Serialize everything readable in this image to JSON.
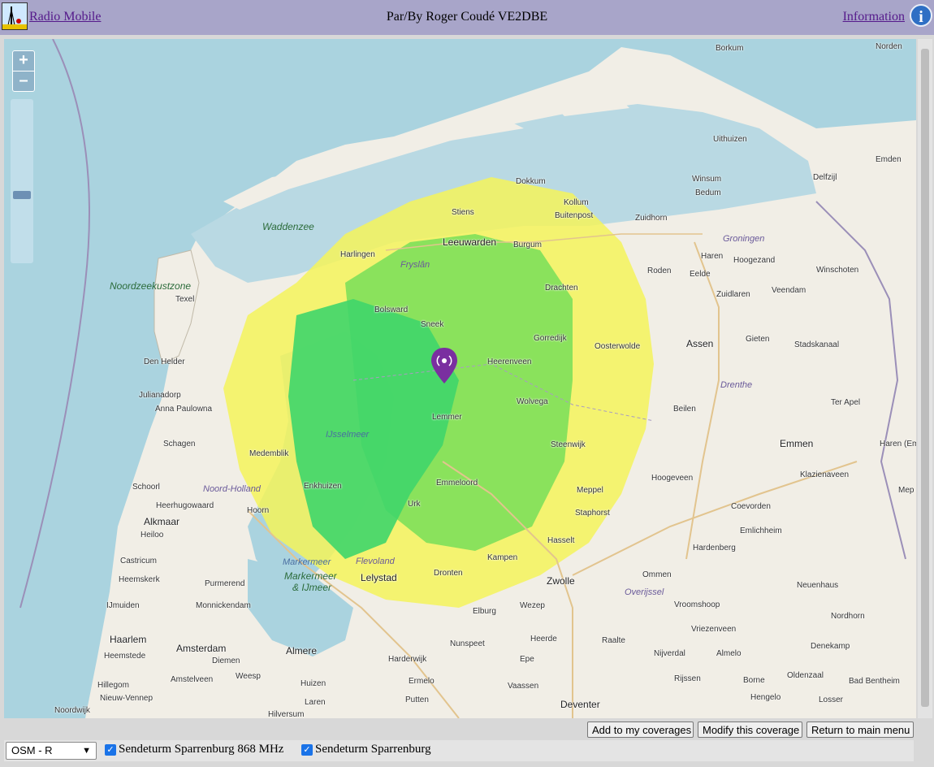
{
  "header": {
    "app_name": "Radio Mobile",
    "author": "Par/By Roger Coudé VE2DBE",
    "info_link": "Information",
    "info_icon": "i"
  },
  "map": {
    "zoom_in": "+",
    "zoom_out": "–",
    "attribution_icon": "i",
    "places": {
      "borkum": "Borkum",
      "norden": "Norden",
      "uithuizen": "Uithuizen",
      "emden": "Emden",
      "delfzijl": "Delfzijl",
      "winsum": "Winsum",
      "bedum": "Bedum",
      "dokkum": "Dokkum",
      "kollum": "Kollum",
      "buitenpost": "Buitenpost",
      "zuidhorn": "Zuidhorn",
      "stiens": "Stiens",
      "leeuwarden": "Leeuwarden",
      "burgum": "Burgum",
      "groningen": "Groningen",
      "haren": "Haren",
      "hoogezand": "Hoogezand",
      "winschoten": "Winschoten",
      "harlingen": "Harlingen",
      "fryslan": "Fryslân",
      "roden": "Roden",
      "eelde": "Eelde",
      "zuidlaren": "Zuidlaren",
      "veendam": "Veendam",
      "drachten": "Drachten",
      "texel": "Texel",
      "bolsward": "Bolsward",
      "sneek": "Sneek",
      "gorredijk": "Gorredijk",
      "assen": "Assen",
      "gieten": "Gieten",
      "stadskanaal": "Stadskanaal",
      "oosterwolde": "Oosterwolde",
      "den_helder": "Den Helder",
      "heerenveen": "Heerenveen",
      "drenthe": "Drenthe",
      "julianadorp": "Julianadorp",
      "wolvega": "Wolvega",
      "ter_apel": "Ter Apel",
      "anna_paulowna": "Anna Paulowna",
      "lemmer": "Lemmer",
      "beilen": "Beilen",
      "schagen": "Schagen",
      "medemblik": "Medemblik",
      "ijsselmeer": "IJsselmeer",
      "steenwijk": "Steenwijk",
      "emmen": "Emmen",
      "haren_ems": "Haren (Em",
      "klazienaveen": "Klazienaveen",
      "hoogeveen": "Hoogeveen",
      "schoorl": "Schoorl",
      "noord_holland": "Noord-Holland",
      "enkhuizen": "Enkhuizen",
      "emmeloord": "Emmeloord",
      "meppel": "Meppel",
      "mep": "Mep",
      "heerhugowaard": "Heerhugowaard",
      "hoorn": "Hoorn",
      "urk": "Urk",
      "staphorst": "Staphorst",
      "coevorden": "Coevorden",
      "alkmaar": "Alkmaar",
      "heiloo": "Heiloo",
      "emlichheim": "Emlichheim",
      "hasselt": "Hasselt",
      "castricum": "Castricum",
      "markermeer": "Markermeer",
      "flevoland": "Flevoland",
      "kampen": "Kampen",
      "hardenberg": "Hardenberg",
      "heemskerk": "Heemskerk",
      "purmerend": "Purmerend",
      "lelystad": "Lelystad",
      "dronten": "Dronten",
      "zwolle": "Zwolle",
      "ommen": "Ommen",
      "neuenhaus": "Neuenhaus",
      "markermeer_ijmeer_1": "Markermeer",
      "markermeer_ijmeer_2": "& IJmeer",
      "ijmuiden": "IJmuiden",
      "monnickendam": "Monnickendam",
      "overijssel": "Overijssel",
      "elburg": "Elburg",
      "wezep": "Wezep",
      "vroomshoop": "Vroomshoop",
      "nordhorn": "Nordhorn",
      "haarlem": "Haarlem",
      "amsterdam": "Amsterdam",
      "vriezenveen": "Vriezenveen",
      "heemstede": "Heemstede",
      "almere": "Almere",
      "nunspeet": "Nunspeet",
      "raalte": "Raalte",
      "denekamp": "Denekamp",
      "nijverdal": "Nijverdal",
      "almelo": "Almelo",
      "hillegom": "Hillegom",
      "amstelveen": "Amstelveen",
      "diemen": "Diemen",
      "weesp": "Weesp",
      "huizen": "Huizen",
      "harderwijk": "Harderwijk",
      "ermelo": "Ermelo",
      "epe": "Epe",
      "heerde": "Heerde",
      "oldenzaal": "Oldenzaal",
      "rijssen": "Rijssen",
      "borne": "Borne",
      "bad_bentheim": "Bad Bentheim",
      "nieuw_vennep": "Nieuw-Vennep",
      "laren": "Laren",
      "putten": "Putten",
      "vaassen": "Vaassen",
      "hengelo": "Hengelo",
      "losser": "Losser",
      "deventer": "Deventer",
      "noordwijk": "Noordwijk",
      "hilversum": "Hilversum",
      "waddenzee": "Waddenzee",
      "noordzeekustzone": "Noordzeekustzone"
    }
  },
  "buttons": {
    "add": "Add to my coverages",
    "modify": "Modify this coverage",
    "return": "Return to main menu"
  },
  "bottom": {
    "basemap": "OSM - R",
    "layer1": "Sendeturm Sparrenburg 868 MHz",
    "layer2": "Sendeturm Sparrenburg"
  },
  "colors": {
    "header_bg": "#a8a5c9",
    "coverage_strong": "#3fd66a",
    "coverage_medium": "#7ee05a",
    "coverage_weak": "#f4f35a",
    "marker": "#7a2fa0"
  }
}
